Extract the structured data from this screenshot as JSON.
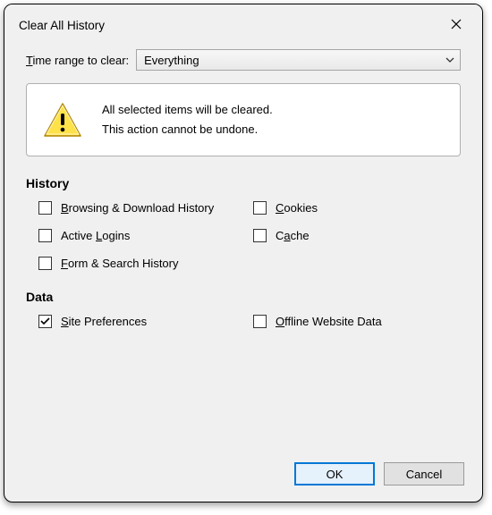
{
  "dialog": {
    "title": "Clear All History",
    "range_label_pre": "T",
    "range_label_rest": "ime range to clear:",
    "range_value": "Everything",
    "warning_line1": "All selected items will be cleared.",
    "warning_line2": "This action cannot be undone."
  },
  "sections": {
    "history_title": "History",
    "data_title": "Data"
  },
  "checkboxes": {
    "browsing": {
      "pre": "B",
      "rest": "rowsing & Download History",
      "checked": false
    },
    "cookies": {
      "pre": "C",
      "rest": "ookies",
      "checked": false
    },
    "logins": {
      "pre": "",
      "mid_pre": "Active ",
      "u": "L",
      "mid_post": "ogins",
      "checked": false
    },
    "cache": {
      "pre": "",
      "mid_pre": "C",
      "u": "a",
      "mid_post": "che",
      "checked": false
    },
    "forms": {
      "pre": "F",
      "rest": "orm & Search History",
      "checked": false
    },
    "siteprefs": {
      "pre": "S",
      "rest": "ite Preferences",
      "checked": true
    },
    "offline": {
      "pre": "O",
      "rest": "ffline Website Data",
      "checked": false
    }
  },
  "buttons": {
    "ok": "OK",
    "cancel": "Cancel"
  }
}
